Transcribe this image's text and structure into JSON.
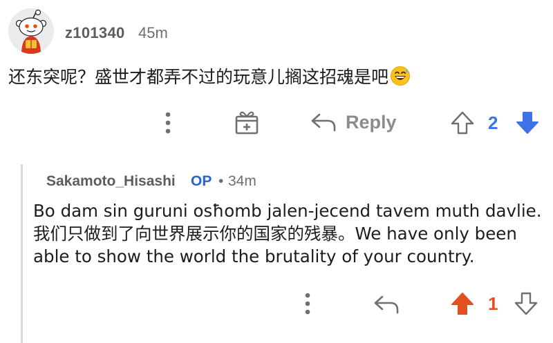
{
  "comment": {
    "author": "z101340",
    "time": "45m",
    "body": "还东突呢？盛世才都弄不过的玩意儿搁这招魂是吧",
    "emoji_icon": "grinning-sweat-emoji",
    "reply_label": "Reply",
    "score": "2",
    "vote_state": "downvoted",
    "colors": {
      "downvote_blue": "#3e73e6",
      "muted": "#6d6f72"
    }
  },
  "reply": {
    "author": "Sakamoto_Hisashi",
    "op_badge": "OP",
    "separator": "•",
    "time": "34m",
    "body": "Bo dam sin guruni osħomb jalen-jecend tavem muth davlie. 我们只做到了向世界展示你的国家的残暴。We have only been able to show the world the brutality of your country.",
    "score": "1",
    "vote_state": "upvoted",
    "colors": {
      "upvote_orange": "#e44f22",
      "op_blue": "#2a63c9"
    }
  },
  "icons": {
    "more": "more-vertical-icon",
    "award": "gift-award-icon",
    "reply": "reply-arrow-icon",
    "upvote": "upvote-arrow-icon",
    "downvote": "downvote-arrow-icon",
    "avatar": "reddit-snoo-avatar"
  }
}
